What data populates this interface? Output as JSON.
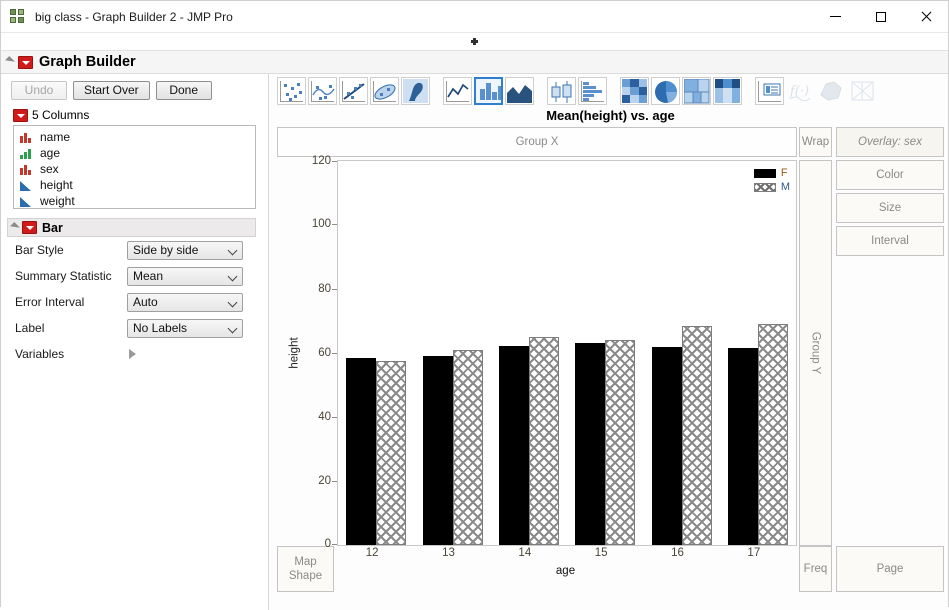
{
  "window": {
    "title": "big class - Graph Builder 2 - JMP Pro",
    "app_icon": "jmp-icon",
    "minimize_label": "Minimize",
    "maximize_label": "Maximize",
    "close_label": "Close"
  },
  "outline": {
    "title": "Graph Builder"
  },
  "toolbar_buttons": [
    {
      "label": "Undo",
      "enabled": false
    },
    {
      "label": "Start Over",
      "enabled": true
    },
    {
      "label": "Done",
      "enabled": true
    }
  ],
  "columns_panel": {
    "header": "5 Columns",
    "items": [
      {
        "name": "name",
        "type": "nominal"
      },
      {
        "name": "age",
        "type": "ordinal"
      },
      {
        "name": "sex",
        "type": "nominal"
      },
      {
        "name": "height",
        "type": "continuous"
      },
      {
        "name": "weight",
        "type": "continuous"
      }
    ]
  },
  "bar_panel": {
    "title": "Bar",
    "options": [
      {
        "label": "Bar Style",
        "value": "Side by side"
      },
      {
        "label": "Summary Statistic",
        "value": "Mean"
      },
      {
        "label": "Error Interval",
        "value": "Auto"
      },
      {
        "label": "Label",
        "value": "No Labels"
      }
    ],
    "variables_label": "Variables"
  },
  "graph_toolbar": {
    "icons": [
      {
        "name": "points-icon",
        "selected": false,
        "enabled": true
      },
      {
        "name": "smoother-icon",
        "selected": false,
        "enabled": true
      },
      {
        "name": "line-of-fit-icon",
        "selected": false,
        "enabled": true
      },
      {
        "name": "ellipse-icon",
        "selected": false,
        "enabled": true
      },
      {
        "name": "contour-icon",
        "selected": false,
        "enabled": true
      },
      {
        "name": "line-chart-icon",
        "selected": false,
        "enabled": true
      },
      {
        "name": "bar-chart-icon",
        "selected": true,
        "enabled": true
      },
      {
        "name": "area-chart-icon",
        "selected": false,
        "enabled": true
      },
      {
        "name": "box-plot-icon",
        "selected": false,
        "enabled": true
      },
      {
        "name": "histogram-icon",
        "selected": false,
        "enabled": true
      },
      {
        "name": "heatmap-icon",
        "selected": false,
        "enabled": true
      },
      {
        "name": "pie-chart-icon",
        "selected": false,
        "enabled": true
      },
      {
        "name": "treemap-icon",
        "selected": false,
        "enabled": true
      },
      {
        "name": "mosaic-icon",
        "selected": false,
        "enabled": true
      },
      {
        "name": "caption-box-icon",
        "selected": false,
        "enabled": true
      },
      {
        "name": "formula-icon",
        "selected": false,
        "enabled": false
      },
      {
        "name": "map-shapes-icon",
        "selected": false,
        "enabled": false
      },
      {
        "name": "parallel-plot-icon",
        "selected": false,
        "enabled": false
      }
    ]
  },
  "dropzones": {
    "group_x": "Group X",
    "wrap": "Wrap",
    "overlay": "Overlay: sex",
    "group_y": "Group Y",
    "color": "Color",
    "size": "Size",
    "interval": "Interval",
    "map_shape": "Map\nShape",
    "map_shape_line1": "Map",
    "map_shape_line2": "Shape",
    "freq": "Freq",
    "page": "Page"
  },
  "chart_data": {
    "type": "bar",
    "title": "Mean(height) vs. age",
    "xlabel": "age",
    "ylabel": "height",
    "categories": [
      "12",
      "13",
      "14",
      "15",
      "16",
      "17"
    ],
    "ylim": [
      0,
      120
    ],
    "yticks": [
      0,
      20,
      40,
      60,
      80,
      100,
      120
    ],
    "grid": false,
    "legend_title": "sex",
    "legend_position": "top-right",
    "series": [
      {
        "name": "F",
        "values": [
          58.5,
          59.0,
          62.3,
          63.0,
          62.0,
          61.5
        ],
        "fill": "solid-black",
        "color": "#000000"
      },
      {
        "name": "M",
        "values": [
          57.5,
          61.0,
          65.0,
          64.0,
          68.5,
          69.0
        ],
        "fill": "crosshatch",
        "color": "#8a8a8a"
      }
    ]
  },
  "colors": {
    "accent": "#2f7fd0",
    "tick_text": "#4a4436",
    "dropzone_text": "#8a8a8a",
    "legend_f_text": "#9c5a12",
    "legend_m_text": "#2b5a8c"
  }
}
